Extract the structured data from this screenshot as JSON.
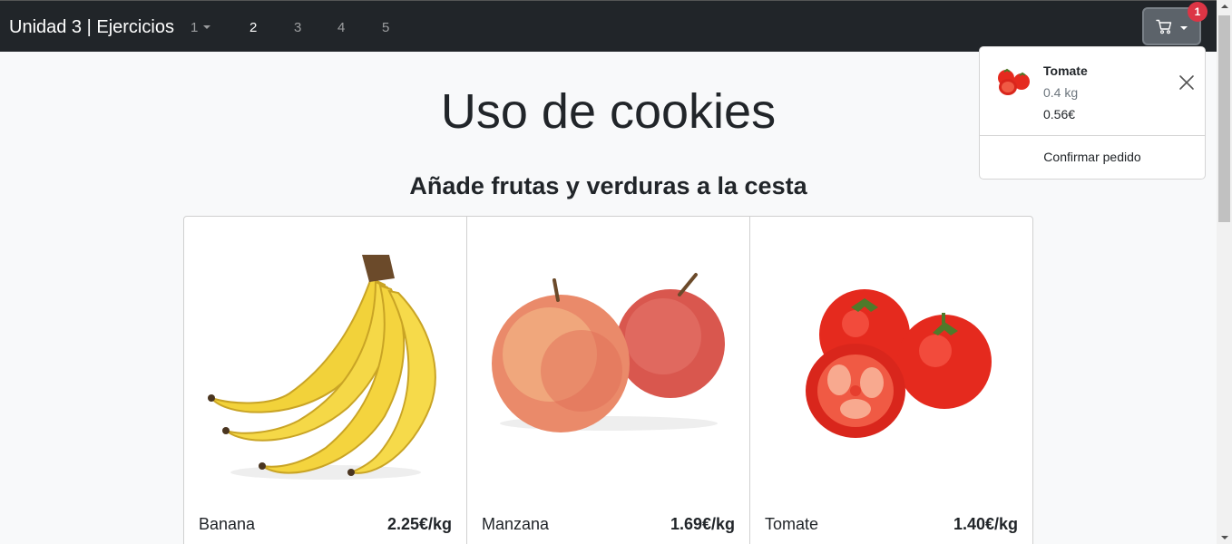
{
  "navbar": {
    "brand": "Unidad 3 | Ejercicios",
    "links": [
      {
        "label": "1"
      },
      {
        "label": "2"
      },
      {
        "label": "3"
      },
      {
        "label": "4"
      },
      {
        "label": "5"
      }
    ],
    "cart_icon": "cart-icon",
    "cart_count": "1"
  },
  "page": {
    "title": "Uso de cookies",
    "subtitle": "Añade frutas y verduras a la cesta"
  },
  "products": [
    {
      "name": "Banana",
      "price": "2.25€/kg",
      "image": "banana-image"
    },
    {
      "name": "Manzana",
      "price": "1.69€/kg",
      "image": "apple-image"
    },
    {
      "name": "Tomate",
      "price": "1.40€/kg",
      "image": "tomato-image"
    }
  ],
  "cart_dropdown": {
    "item": {
      "name": "Tomate",
      "quantity": "0.4 kg",
      "total": "0.56€"
    },
    "confirm_label": "Confirmar pedido"
  },
  "colors": {
    "navbar_bg": "#212529",
    "badge": "#dc3545",
    "page_bg": "#f8f9fa"
  }
}
